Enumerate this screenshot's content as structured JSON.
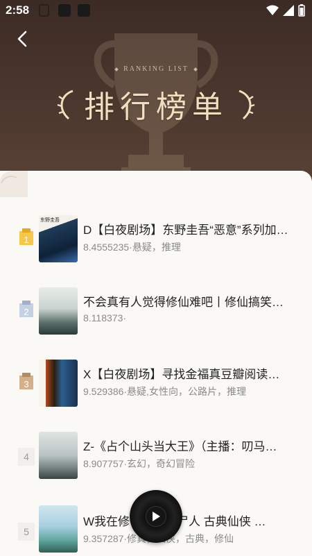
{
  "status_bar": {
    "time": "2:58"
  },
  "header": {
    "subtitle": "RANKING LIST",
    "title": "排行榜单"
  },
  "colors": {
    "header_bg": "#3c2b25",
    "title_gold": "#f1dfbe",
    "gold": "#f4c542",
    "silver": "#b9c6da",
    "bronze": "#c9a57c"
  },
  "books": [
    {
      "rank": "1",
      "title": "D【白夜剧场】东野圭吾“恶意”系列加…",
      "meta": "8.4555235·悬疑，推理",
      "badge": "gold"
    },
    {
      "rank": "2",
      "title": "不会真有人觉得修仙难吧丨修仙搞笑…",
      "meta": "8.118373·",
      "badge": "silver"
    },
    {
      "rank": "3",
      "title": "X【白夜剧场】寻找金福真豆瓣阅读…",
      "meta": "9.529386·悬疑,女性向，公路片，推理",
      "badge": "bronze"
    },
    {
      "rank": "4",
      "title": "Z-《占个山头当大王》（主播：叨马…",
      "meta": "8.907757·玄幻，奇幻冒险",
      "badge": "plain"
    },
    {
      "rank": "5",
      "title": "W我在修仙界当敛尸人 古典仙侠 …",
      "meta": "9.357287·修真，仙侠，古典，修仙",
      "badge": "plain"
    }
  ],
  "player": {
    "icon": "play-icon"
  }
}
